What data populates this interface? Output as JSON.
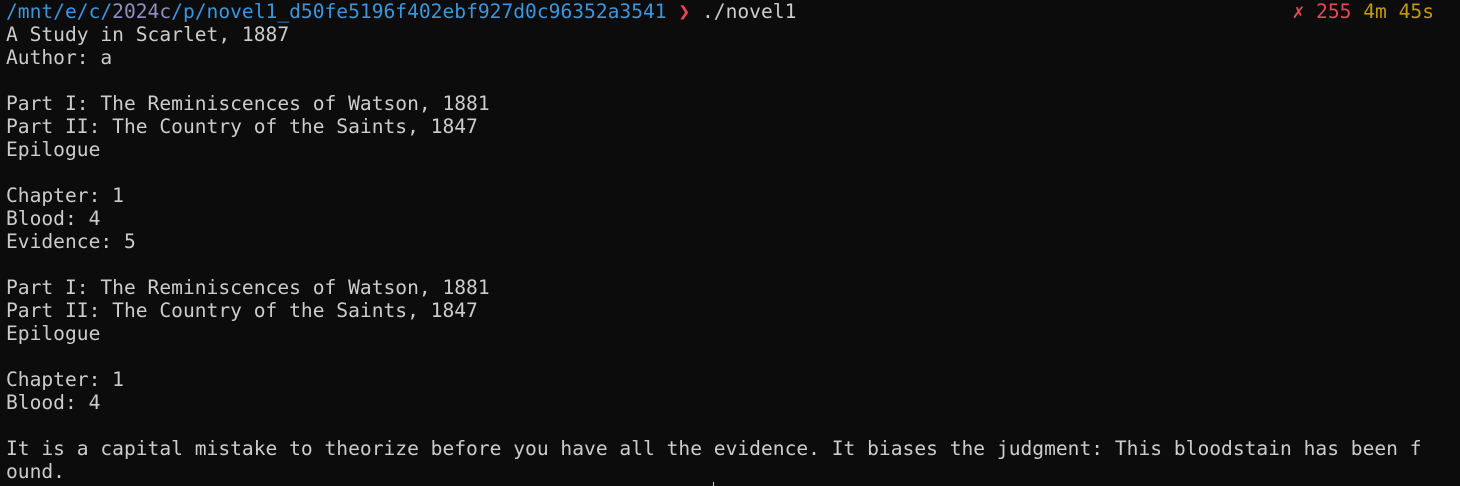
{
  "prompt": {
    "path_prefix": "/mnt/e/c/",
    "path_dim": "2024c",
    "path_mid": "/p/",
    "path_rest": "novel1_d50fe5196f402ebf927d0c96352a3541",
    "chevron": "❯",
    "command": "./novel1"
  },
  "status": {
    "fail_mark": "✗",
    "exit_code": "255",
    "duration": "4m 45s"
  },
  "output": [
    "A Study in Scarlet, 1887",
    "Author: a",
    "",
    "Part I: The Reminiscences of Watson, 1881",
    "Part II: The Country of the Saints, 1847",
    "Epilogue",
    "",
    "Chapter: 1",
    "Blood: 4",
    "Evidence: 5",
    "",
    "Part I: The Reminiscences of Watson, 1881",
    "Part II: The Country of the Saints, 1847",
    "Epilogue",
    "",
    "Chapter: 1",
    "Blood: 4",
    "",
    "It is a capital mistake to theorize before you have all the evidence. It biases the judgment: This bloodstain has been f",
    "ound."
  ]
}
